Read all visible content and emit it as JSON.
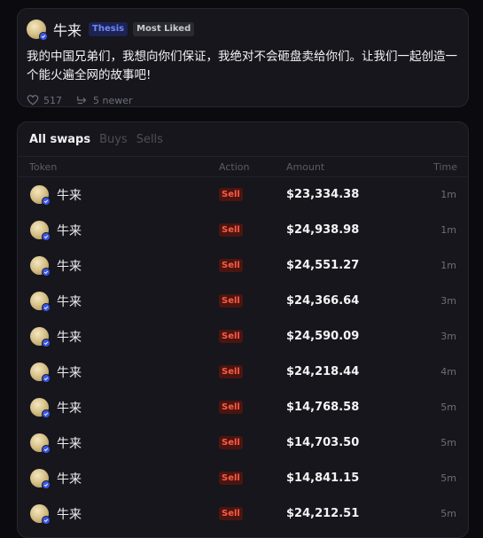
{
  "post": {
    "author": "牛来",
    "tags": {
      "thesis": "Thesis",
      "most_liked": "Most Liked"
    },
    "body": "我的中国兄弟们，我想向你们保证，我绝对不会砸盘卖给你们。让我们一起创造一个能火遍全网的故事吧!",
    "likes": "517",
    "newer": "5 newer"
  },
  "swaps": {
    "tabs": [
      "All swaps",
      "Buys",
      "Sells"
    ],
    "active_tab": "All swaps",
    "columns": {
      "token": "Token",
      "action": "Action",
      "amount": "Amount",
      "time": "Time"
    },
    "rows": [
      {
        "token": "牛来",
        "action": "Sell",
        "amount": "$23,334.38",
        "time": "1m"
      },
      {
        "token": "牛来",
        "action": "Sell",
        "amount": "$24,938.98",
        "time": "1m"
      },
      {
        "token": "牛来",
        "action": "Sell",
        "amount": "$24,551.27",
        "time": "1m"
      },
      {
        "token": "牛来",
        "action": "Sell",
        "amount": "$24,366.64",
        "time": "3m"
      },
      {
        "token": "牛来",
        "action": "Sell",
        "amount": "$24,590.09",
        "time": "3m"
      },
      {
        "token": "牛来",
        "action": "Sell",
        "amount": "$24,218.44",
        "time": "4m"
      },
      {
        "token": "牛来",
        "action": "Sell",
        "amount": "$14,768.58",
        "time": "5m"
      },
      {
        "token": "牛来",
        "action": "Sell",
        "amount": "$14,703.50",
        "time": "5m"
      },
      {
        "token": "牛来",
        "action": "Sell",
        "amount": "$14,841.15",
        "time": "5m"
      },
      {
        "token": "牛来",
        "action": "Sell",
        "amount": "$24,212.51",
        "time": "5m"
      }
    ]
  },
  "icons": {
    "like": "heart-icon",
    "newer": "reply-arrow-icon",
    "verified": "verified-badge-icon",
    "token_avatar": "token-avatar"
  },
  "colors": {
    "background": "#0b0b0f",
    "card": "#16161c",
    "thesis_tag": "#6f86ff",
    "sell": "#ff5a45",
    "verified": "#3b57e8"
  }
}
